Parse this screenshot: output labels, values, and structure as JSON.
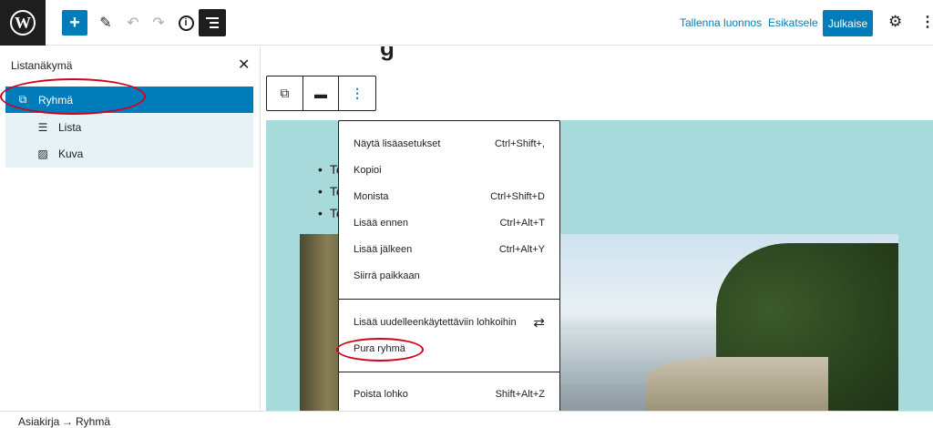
{
  "topbar": {
    "save_draft": "Tallenna luonnos",
    "preview": "Esikatsele",
    "publish": "Julkaise"
  },
  "panel": {
    "title": "Listanäkymä",
    "items": [
      {
        "label": "Ryhmä",
        "icon": "group-icon"
      },
      {
        "label": "Lista",
        "icon": "list-icon"
      },
      {
        "label": "Kuva",
        "icon": "image-icon"
      }
    ]
  },
  "content": {
    "list_items": [
      "Te",
      "Te",
      "Te"
    ]
  },
  "menu": {
    "items": [
      {
        "label": "Näytä lisäasetukset",
        "shortcut": "Ctrl+Shift+,"
      },
      {
        "label": "Kopioi",
        "shortcut": ""
      },
      {
        "label": "Monista",
        "shortcut": "Ctrl+Shift+D"
      },
      {
        "label": "Lisää ennen",
        "shortcut": "Ctrl+Alt+T"
      },
      {
        "label": "Lisää jälkeen",
        "shortcut": "Ctrl+Alt+Y"
      },
      {
        "label": "Siirrä paikkaan",
        "shortcut": ""
      },
      {
        "label": "Lisää uudelleenkäytettäviin lohkoihin",
        "icon": "reusable-icon"
      },
      {
        "label": "Pura ryhmä",
        "shortcut": ""
      },
      {
        "label": "Poista lohko",
        "shortcut": "Shift+Alt+Z"
      }
    ]
  },
  "breadcrumb": {
    "root": "Asiakirja",
    "arrow": "→",
    "current": "Ryhmä"
  },
  "colors": {
    "accent": "#007cba",
    "group_background": "#a8d9db",
    "annotation": "#d0021b"
  }
}
